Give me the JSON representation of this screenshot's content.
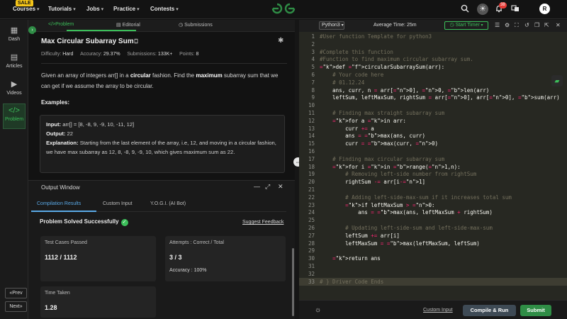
{
  "topnav": {
    "sale_badge": "SALE",
    "items": [
      {
        "label": "Courses"
      },
      {
        "label": "Tutorials"
      },
      {
        "label": "Jobs"
      },
      {
        "label": "Practice"
      },
      {
        "label": "Contests"
      }
    ],
    "notification_count": "38",
    "avatar_letter": "R"
  },
  "sidebar": {
    "items": [
      {
        "label": "Dash",
        "icon": "grid-icon"
      },
      {
        "label": "Articles",
        "icon": "article-icon"
      },
      {
        "label": "Videos",
        "icon": "video-icon"
      },
      {
        "label": "Problem",
        "icon": "code-icon"
      }
    ],
    "prev_label": "Prev",
    "next_label": "Next"
  },
  "problem_tabs": [
    {
      "label": "Problem"
    },
    {
      "label": "Editorial"
    },
    {
      "label": "Submissions"
    }
  ],
  "problem": {
    "title": "Max Circular Subarray Sum",
    "difficulty_label": "Difficulty:",
    "difficulty": "Hard",
    "accuracy_label": "Accuracy:",
    "accuracy": "29.37%",
    "submissions_label": "Submissions:",
    "submissions": "133K+",
    "points_label": "Points:",
    "points": "8",
    "desc_1": "Given an array of integers arr[] in a ",
    "desc_bold_1": "circular",
    "desc_2": " fashion. Find the ",
    "desc_bold_2": "maximum",
    "desc_3": " subarray sum that we can get if we assume the array to be circular.",
    "examples_label": "Examples:",
    "input_label": "Input:",
    "input_value": "arr[] = [8, -8, 9, -9, 10, -11, 12]",
    "output_label": "Output:",
    "output_value": "22",
    "explanation_label": "Explanation:",
    "explanation_value": "Starting from the last element of the array, i.e, 12, and moving in a circular fashion, we have max subarray as 12, 8, -8, 9, -9, 10, which gives maximum sum as 22."
  },
  "output_window": {
    "title": "Output Window",
    "tabs": [
      {
        "label": "Compilation Results"
      },
      {
        "label": "Custom Input"
      },
      {
        "label": "Y.O.G.I. (AI Bot)"
      }
    ],
    "status": "Problem Solved Successfully",
    "feedback_link": "Suggest Feedback",
    "cards": {
      "tests_label": "Test Cases Passed",
      "tests_value": "1112 / 1112",
      "attempts_label": "Attempts : Correct / Total",
      "attempts_value": "3 / 3",
      "accuracy_text": "Accuracy : 100%",
      "time_label": "Time Taken",
      "time_value": "1.28"
    }
  },
  "editor": {
    "language": "Python3",
    "avg_time": "Average Time: 25m",
    "timer_label": "Start Timer",
    "lines": [
      {
        "n": "1",
        "t": "#User function Template for python3"
      },
      {
        "n": "2",
        "t": ""
      },
      {
        "n": "3",
        "t": "#Complete this function"
      },
      {
        "n": "4",
        "t": "#Function to find maximum circular subarray sum."
      },
      {
        "n": "5",
        "t": "def circularSubarraySum(arr):"
      },
      {
        "n": "6",
        "t": "    # Your code here"
      },
      {
        "n": "7",
        "t": "    # 01.12.24"
      },
      {
        "n": "8",
        "t": "    ans, curr, n = arr[0], 0, len(arr)"
      },
      {
        "n": "9",
        "t": "    leftSum, leftMaxSum, rightSum = arr[0], arr[0], sum(arr)"
      },
      {
        "n": "10",
        "t": ""
      },
      {
        "n": "11",
        "t": "    # Finding max straight subarray sum"
      },
      {
        "n": "12",
        "t": "    for a in arr:"
      },
      {
        "n": "13",
        "t": "        curr += a"
      },
      {
        "n": "14",
        "t": "        ans = max(ans, curr)"
      },
      {
        "n": "15",
        "t": "        curr = max(curr, 0)"
      },
      {
        "n": "16",
        "t": ""
      },
      {
        "n": "17",
        "t": "    # Finding max circular subarray sum"
      },
      {
        "n": "18",
        "t": "    for i in range(1,n):"
      },
      {
        "n": "19",
        "t": "        # Removing left-side number from rightSum"
      },
      {
        "n": "20",
        "t": "        rightSum -= arr[i-1]"
      },
      {
        "n": "21",
        "t": ""
      },
      {
        "n": "22",
        "t": "        # Adding left-side-max-sum if it increases total sum"
      },
      {
        "n": "23",
        "t": "        if leftMaxSum > 0:"
      },
      {
        "n": "24",
        "t": "            ans = max(ans, leftMaxSum + rightSum)"
      },
      {
        "n": "25",
        "t": ""
      },
      {
        "n": "26",
        "t": "        # Updating left-side-sum and left-side-max-sum"
      },
      {
        "n": "27",
        "t": "        leftSum += arr[i]"
      },
      {
        "n": "28",
        "t": "        leftMaxSum = max(leftMaxSum, leftSum)"
      },
      {
        "n": "29",
        "t": ""
      },
      {
        "n": "30",
        "t": "    return ans"
      },
      {
        "n": "31",
        "t": ""
      },
      {
        "n": "32",
        "t": ""
      },
      {
        "n": "33",
        "t": "# } Driver Code Ends"
      }
    ],
    "custom_input_label": "Custom Input",
    "compile_label": "Compile & Run",
    "submit_label": "Submit"
  },
  "colors": {
    "accent_green": "#2f8d46",
    "tab_blue": "#5aa9e6",
    "editor_bg": "#272822"
  }
}
